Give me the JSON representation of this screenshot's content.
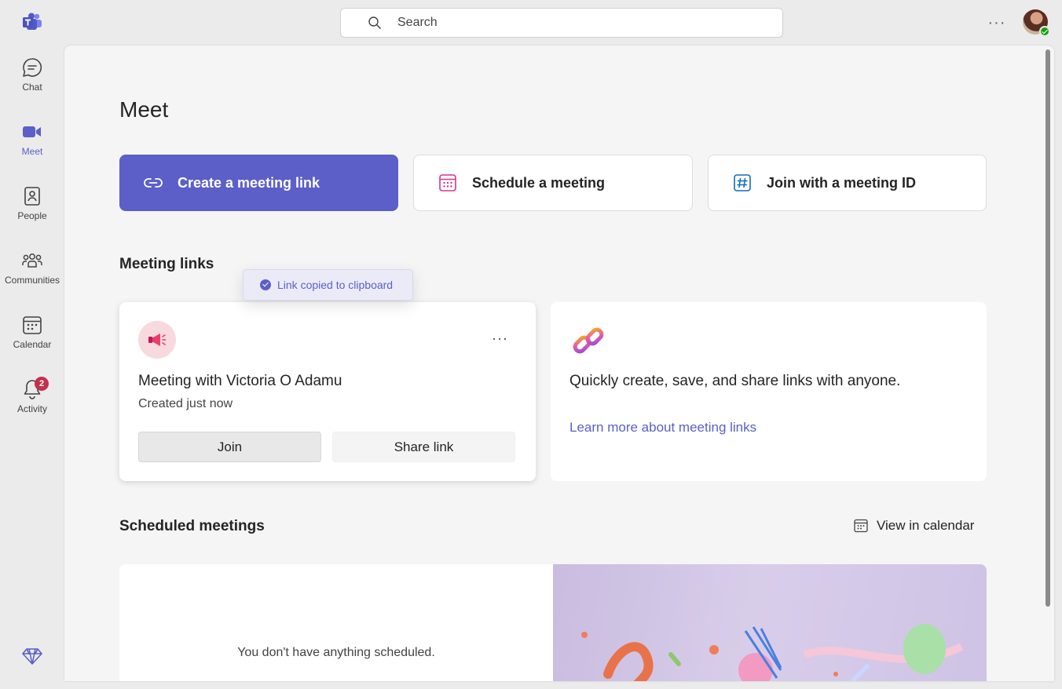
{
  "search": {
    "placeholder": "Search"
  },
  "sidebar": {
    "items": [
      {
        "label": "Chat"
      },
      {
        "label": "Meet"
      },
      {
        "label": "People"
      },
      {
        "label": "Communities"
      },
      {
        "label": "Calendar"
      },
      {
        "label": "Activity",
        "badge": "2"
      }
    ]
  },
  "main": {
    "title": "Meet",
    "actions": {
      "create": "Create a meeting link",
      "schedule": "Schedule a meeting",
      "join": "Join with a meeting ID"
    },
    "meeting_links": {
      "title": "Meeting links",
      "toast": "Link copied to clipboard",
      "card": {
        "title": "Meeting with Victoria O Adamu",
        "subtitle": "Created just now",
        "join": "Join",
        "share": "Share link"
      },
      "info": {
        "text": "Quickly create, save, and share links with anyone.",
        "link": "Learn more about meeting links"
      }
    },
    "scheduled": {
      "title": "Scheduled meetings",
      "view_calendar": "View in calendar",
      "empty": "You don't have anything scheduled."
    }
  },
  "colors": {
    "accent": "#5b5fc7",
    "badge": "#c4314b",
    "presence": "#13a10e"
  },
  "icons": [
    "teams-logo-icon",
    "search-icon",
    "more-icon",
    "chat-icon",
    "video-icon",
    "people-icon",
    "communities-icon",
    "calendar-icon",
    "bell-icon",
    "premium-icon",
    "link-icon",
    "hashtag-icon",
    "megaphone-icon"
  ]
}
